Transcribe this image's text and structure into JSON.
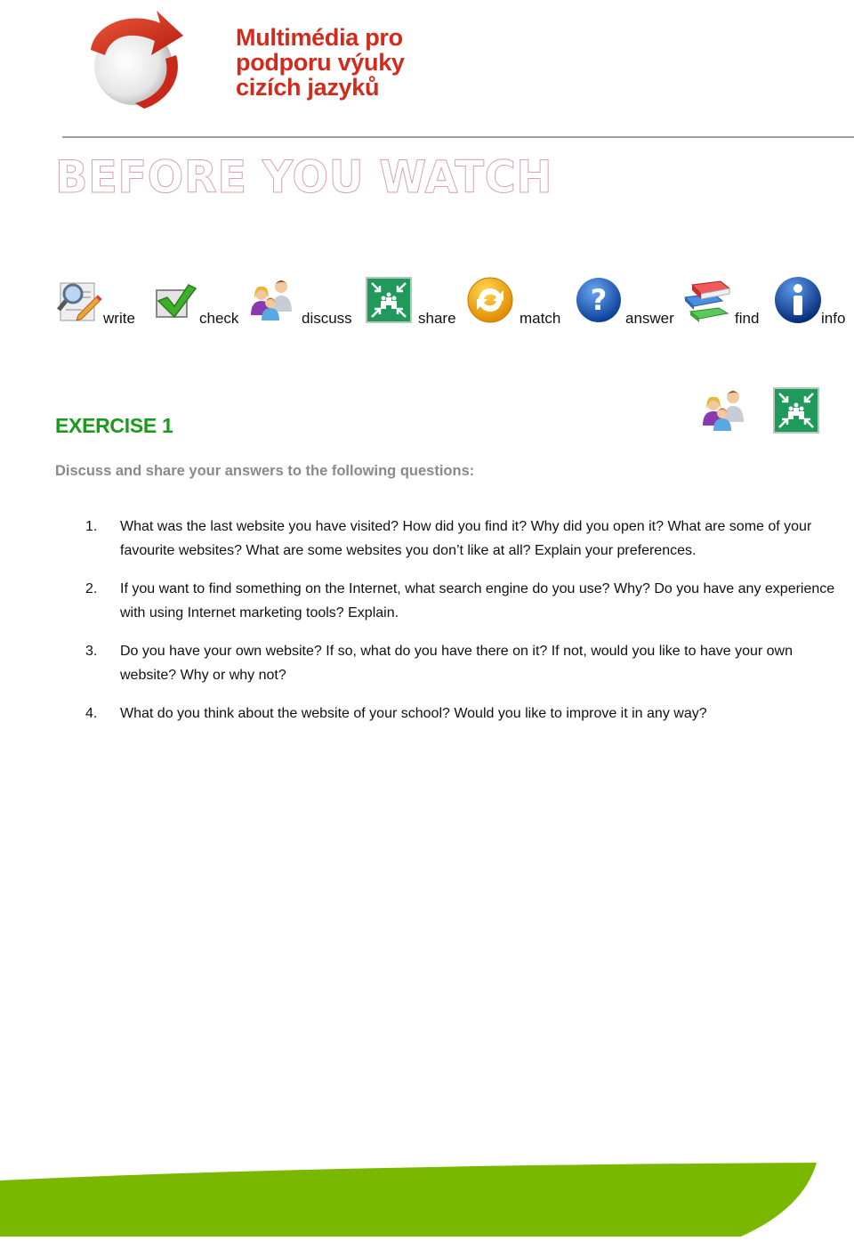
{
  "header": {
    "logo_icon": "red-arrow-sphere-logo",
    "brand_lines": [
      "Multimédia pro",
      "podporu výuky",
      "cizích jazyků"
    ]
  },
  "section": {
    "title": "BEFORE YOU WATCH"
  },
  "legend": {
    "items": [
      {
        "icon": "write-magnifier-pencil-icon",
        "label": "write"
      },
      {
        "icon": "checkmark-icon",
        "label": "check"
      },
      {
        "icon": "people-discuss-icon",
        "label": "discuss"
      },
      {
        "icon": "share-assembly-icon",
        "label": "share"
      },
      {
        "icon": "match-refresh-icon",
        "label": "match"
      },
      {
        "icon": "question-mark-icon",
        "label": "answer"
      },
      {
        "icon": "books-stack-icon",
        "label": "find"
      },
      {
        "icon": "info-icon",
        "label": "info"
      }
    ]
  },
  "exercise": {
    "title": "EXERCISE 1",
    "activity_icons": [
      "people-discuss-icon",
      "share-assembly-icon"
    ],
    "instructions": "Discuss and share your answers to the following questions:",
    "questions": [
      {
        "number": "1.",
        "text": "What was the last website you have visited? How did you find it? Why did you open it? What are some of your favourite websites? What are some websites you don’t like at all? Explain your preferences."
      },
      {
        "number": "2.",
        "text": "If you want to find something on the Internet, what search engine do you use? Why? Do you have any experience with using Internet marketing tools? Explain."
      },
      {
        "number": "3.",
        "text": "Do you have your own website? If so, what do you have there on it? If not, would you like to have your own website? Why or why not?"
      },
      {
        "number": "4.",
        "text": "What do you think about the website of your school? Would you like to improve it in any way?"
      }
    ]
  },
  "colors": {
    "brand_red": "#d42a1c",
    "exercise_green": "#1a9a1a",
    "instruction_gray": "#8a8a8a",
    "footer_green": "#7ab800",
    "title_outline": "#d8a2a6"
  }
}
